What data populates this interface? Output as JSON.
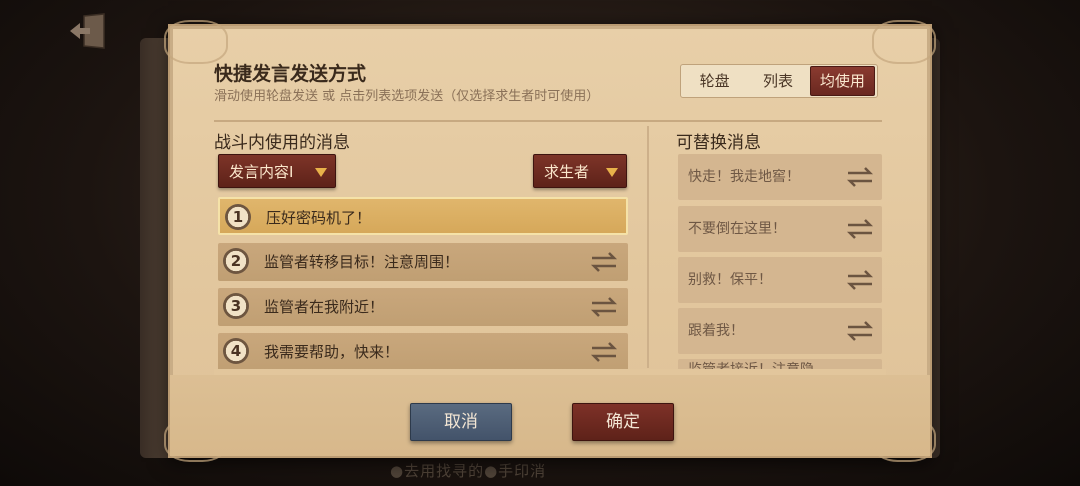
{
  "header": {
    "title": "快捷发言发送方式",
    "subtitle": "滑动使用轮盘发送 或 点击列表选项发送（仅选择求生者时可使用）"
  },
  "mode_toggle": {
    "options": [
      "轮盘",
      "列表",
      "均使用"
    ],
    "selected": "均使用"
  },
  "left_section": {
    "title": "战斗内使用的消息",
    "content_dropdown": "发言内容Ⅰ",
    "role_dropdown": "求生者",
    "messages": [
      {
        "num": "1",
        "text": "压好密码机了！",
        "selected": true
      },
      {
        "num": "2",
        "text": "监管者转移目标！注意周围！",
        "selected": false
      },
      {
        "num": "3",
        "text": "监管者在我附近！",
        "selected": false
      },
      {
        "num": "4",
        "text": "我需要帮助，快来！",
        "selected": false
      }
    ]
  },
  "right_section": {
    "title": "可替换消息",
    "messages": [
      "快走！我走地窖！",
      "不要倒在这里！",
      "别救！保平！",
      "跟着我！",
      "监管者接近！注意隐"
    ]
  },
  "footer": {
    "cancel_label": "取消",
    "confirm_label": "确定"
  },
  "background_hint": "●去用找寻的●手印消"
}
